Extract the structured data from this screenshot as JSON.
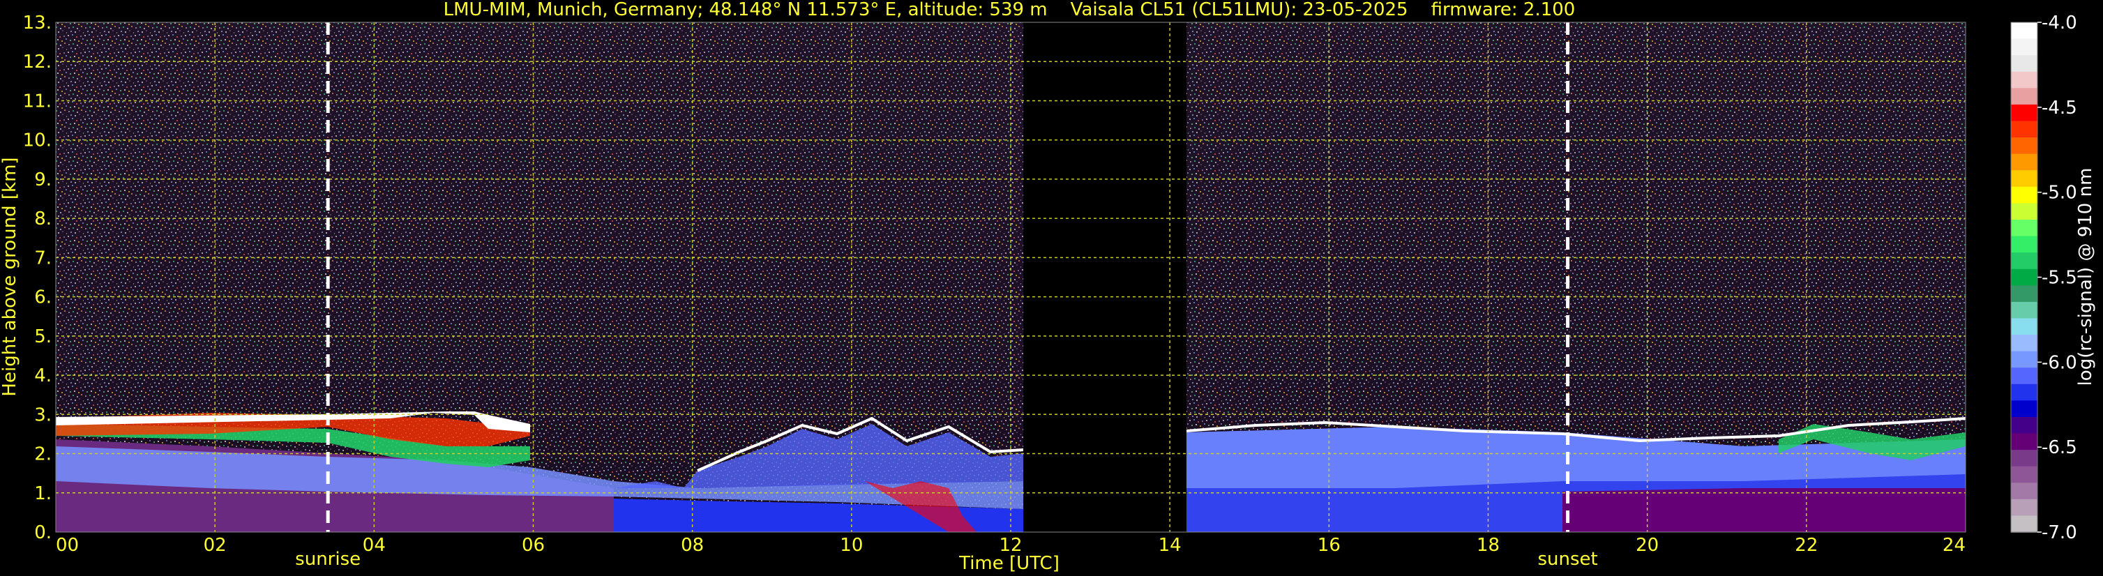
{
  "chart_data": {
    "type": "heatmap",
    "title": "LMU-MIM, Munich, Germany; 48.148° N 11.573° E, altitude: 539 m    Vaisala CL51 (CL51LMU): 23-05-2025    firmware: 2.100",
    "xlabel": "Time [UTC]",
    "ylabel": "Height above ground [km]",
    "colorbar_label": "log(rc-signal) @ 910 nm",
    "xlim": [
      0,
      24
    ],
    "ylim": [
      0,
      13
    ],
    "x_ticks": [
      "00",
      "02",
      "04",
      "06",
      "08",
      "10",
      "12",
      "14",
      "16",
      "18",
      "20",
      "22",
      "24"
    ],
    "y_ticks": [
      "0.",
      "1.",
      "2.",
      "3.",
      "4.",
      "5.",
      "6.",
      "7.",
      "8.",
      "9.",
      "10.",
      "11.",
      "12.",
      "13."
    ],
    "colorbar_range": [
      -7.0,
      -4.0
    ],
    "colorbar_ticks": [
      "-4.0",
      "-4.5",
      "-5.0",
      "-5.5",
      "-6.0",
      "-6.5",
      "-7.0"
    ],
    "colorbar_colors": [
      "#ffffff",
      "#f4f4f4",
      "#e8e8e8",
      "#f3c8c8",
      "#e8a0a0",
      "#ff0000",
      "#ff3300",
      "#ff6600",
      "#ff9900",
      "#ffcc00",
      "#ffff00",
      "#ccff33",
      "#66ff66",
      "#33ee66",
      "#22cc66",
      "#00aa44",
      "#339966",
      "#66ccaa",
      "#88ddee",
      "#99bbff",
      "#7799ff",
      "#5566ff",
      "#2233ee",
      "#0000cc",
      "#440088",
      "#660077",
      "#7a3a8a",
      "#8e5597",
      "#a37aa7",
      "#b8a0b8",
      "#c4c0c4"
    ],
    "grid": true,
    "missing_data_intervals": [
      [
        12.2,
        14.2
      ]
    ],
    "events": [
      {
        "label": "sunrise",
        "time": 3.42
      },
      {
        "label": "sunset",
        "time": 19.0
      }
    ],
    "cloud_top_km": [
      {
        "time": 0,
        "height": 2.85
      },
      {
        "time": 3.4,
        "height": 2.7
      },
      {
        "time": 5,
        "height": 2.9
      },
      {
        "time": 6.0,
        "height": 2.5
      },
      {
        "time": 7,
        "height": 1.2
      },
      {
        "time": 8.5,
        "height": 2.5
      },
      {
        "time": 10.5,
        "height": 1.6
      },
      {
        "time": 12.1,
        "height": 2.1
      },
      {
        "time": 14.2,
        "height": 2.5
      },
      {
        "time": 16,
        "height": 2.8
      },
      {
        "time": 17.5,
        "height": 2.6
      },
      {
        "time": 19,
        "height": 2.2
      },
      {
        "time": 21,
        "height": 2.5
      },
      {
        "time": 24,
        "height": 2.9
      }
    ]
  }
}
